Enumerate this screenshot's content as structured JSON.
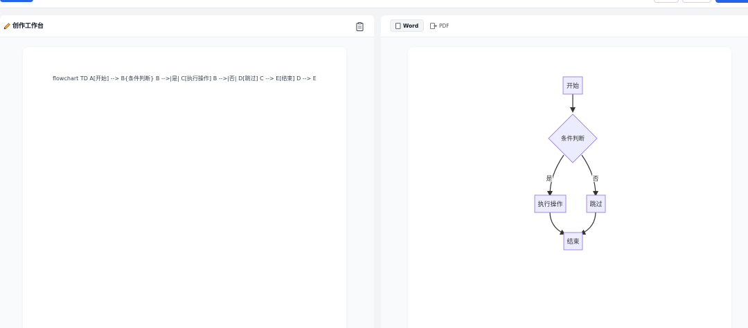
{
  "editor": {
    "title": "创作工作台",
    "content": "flowchart TD A[开始] --> B{条件判断} B -->|是| C[执行操作] B -->|否| D[跳过] C --> E[结束] D --> E"
  },
  "preview": {
    "tabs": [
      {
        "label": "Word",
        "icon": "document-icon"
      },
      {
        "label": "PDF",
        "icon": "export-icon"
      }
    ]
  },
  "flowchart": {
    "nodes": {
      "start": "开始",
      "decision": "条件判断",
      "action": "执行操作",
      "skip": "跳过",
      "end": "结束"
    },
    "edge_labels": {
      "yes": "是",
      "no": "否"
    }
  },
  "colors": {
    "node_fill": "#ECECFF",
    "node_stroke": "#9370DB",
    "edge": "#333333",
    "accent": "#2563eb"
  }
}
